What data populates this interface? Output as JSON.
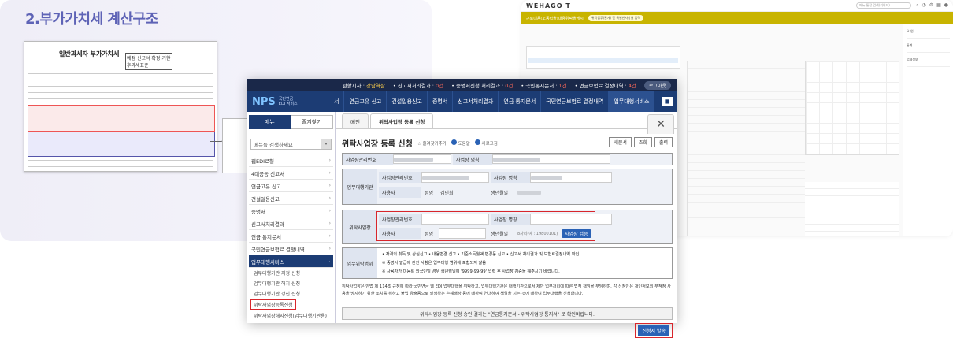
{
  "vat": {
    "title": "2.부가가치세 계산구조",
    "form_title": "일반과세자 부가가치세",
    "form_box": "예정 신고서 확정 기한후과세표준"
  },
  "wehago": {
    "logo": "WEHAGO T",
    "tab_title": "근로내용(노동력을)내용위탁을게시",
    "pill": "위탁업무(관계) 및 특별한사항별 입력",
    "search_placeholder": "메뉴 통합 검색(키워드)",
    "side_labels": [
      "요 언",
      "통계",
      "업체정보"
    ]
  },
  "nps": {
    "topbar": {
      "office_label": "관할지사 :",
      "office_value": "강남역삼",
      "result_label": "신고서처리결과 :",
      "result_value": "0건",
      "cert_label": "증명서신청 처리결과 :",
      "cert_value": "0건",
      "notice_label": "국민통지문서 :",
      "notice_value": "1건",
      "decision_label": "연금보험료 결정내역 :",
      "decision_value": "4건",
      "logout": "로그아웃"
    },
    "logo": {
      "mark": "NPS",
      "name": "국민연금",
      "sub": "EDI 서비스"
    },
    "gnb": [
      "서",
      "연금고유 신고",
      "건설일용신고",
      "증명서",
      "신고서처리결과",
      "연금 통지문서",
      "국민연금보험료 결정내역",
      "업무대행서비스"
    ],
    "lnb": {
      "tab_menu": "메뉴",
      "tab_fav": "즐겨찾기",
      "search_placeholder": "메뉴를 검색하세요",
      "items": [
        "웹EDI로형",
        "4대공동 신고서",
        "연금고유 신고",
        "건설일용신고",
        "증명서",
        "신고서처리결과",
        "연금 통지문서",
        "국민연금보험료 결정내역"
      ],
      "active_item": "업무대행서비스",
      "subs": [
        "업무대행기관 지정 신청",
        "업무대행기관 해지 신청",
        "업무대행기관 갱신 신청"
      ],
      "highlight_sub": "위탁사업장등록신청",
      "last_sub": "위탁사업장해지신청(업무대행기관용)"
    },
    "tabs": [
      "메인",
      "위탁사업장 등록 신청"
    ],
    "page_title": "위탁사업장 등록 신청",
    "title_links": [
      "즐겨찾기추가",
      "도움말",
      "새로고침"
    ],
    "actions": [
      "새문서",
      "조회",
      "출력"
    ],
    "labels": {
      "biz_no": "사업장관리번호",
      "biz_name": "사업장 명칭",
      "agency": "업무대행기관",
      "user": "사용자",
      "name": "성명",
      "birth": "생년월일",
      "entrusted": "위탁사업장",
      "scope": "업무위탁범위"
    },
    "agency_name_value": "김민희",
    "birth_hint": "8자리(예 : 19800101)",
    "verify_button": "사업장 검증",
    "scope_lines": [
      "• 자격의 취득 및 상실신고 • 내용변경 신고 • 기준소득월액 변경등 신고 • 신고서 처리결과 및 보험료결정내역 확인",
      "※ 증명서 발급에 관한 사항은 업무대행 범위에 포함되지 않음",
      "※ 사용자가 미등록 외국인일 경우 생년월일에 '9999-99-99' 입력 후 사업장 검증을 해주시기 바랍니다."
    ],
    "description": "위탁사업장은 안법 제 114조 규정에 따라 국민연금 웹 EDI 업무대행을 위탁하고, 업무대행기관은 대행기관으로서 제반 업무처리에 따른 법적 책임을 부담하며, 각 신청인은 개인정보의 부적정 사용을 방지하기 위한 조치를 취하고 불법 유출등으로 발생하는 손해배상 등에 대하여 연대하여 책임을 지는 것에 대하여 업무대행을 신청합니다.",
    "message": "위탁사업장 등록 신청 승인 결과는 \"연금통지문서 - 위탁사업장 통지서\" 로 확인바랍니다.",
    "submit": "신청서 발송"
  }
}
